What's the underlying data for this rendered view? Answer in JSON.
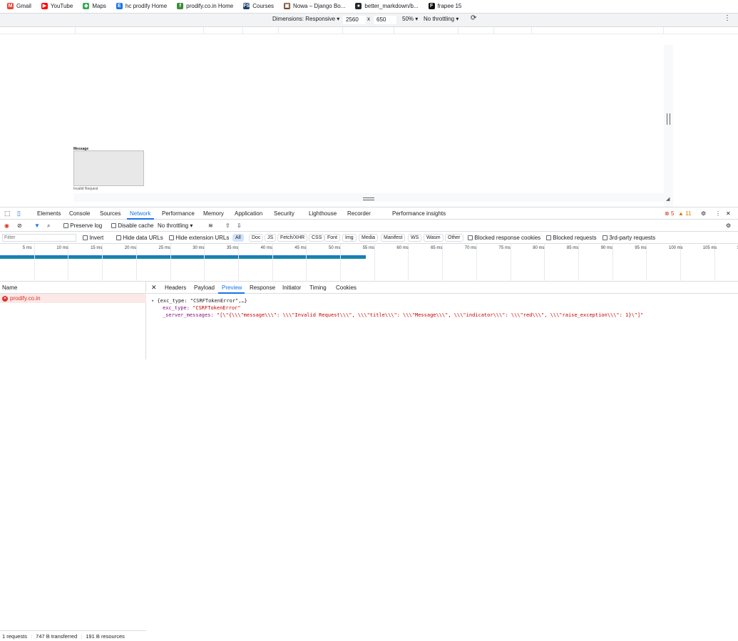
{
  "bookmarks": [
    {
      "label": "Gmail",
      "icon": "gmail-icon",
      "color": "#ea4335",
      "glyph": "M"
    },
    {
      "label": "YouTube",
      "icon": "youtube-icon",
      "color": "#ff0000",
      "glyph": "▶"
    },
    {
      "label": "Maps",
      "icon": "maps-icon",
      "color": "#34a853",
      "glyph": "◆"
    },
    {
      "label": "hc prodify Home",
      "icon": "prodify-icon",
      "color": "#1a73e8",
      "glyph": "E"
    },
    {
      "label": "prodify.co.in Home",
      "icon": "prodify-leaf-icon",
      "color": "#3c8c3c",
      "glyph": "f"
    },
    {
      "label": "Courses",
      "icon": "fs-icon",
      "color": "#1f3b73",
      "glyph": "FS"
    },
    {
      "label": "Nowa – Django Bo...",
      "icon": "nowa-icon",
      "color": "#7a4a2a",
      "glyph": "▣"
    },
    {
      "label": "better_markdown/b...",
      "icon": "github-icon",
      "color": "#24292e",
      "glyph": "●"
    },
    {
      "label": "frapee 15",
      "icon": "frappe-icon",
      "color": "#111111",
      "glyph": "F"
    }
  ],
  "device_toolbar": {
    "dimensions": "Dimensions: Responsive",
    "width": "2560",
    "times": "x",
    "height": "650",
    "zoom": "50%",
    "throttle": "No throttling"
  },
  "viewport": {
    "message_title": "Message",
    "message_text": "Invalid Request"
  },
  "devtools_tabs": [
    "Elements",
    "Console",
    "Sources",
    "Network",
    "Performance",
    "Memory",
    "Application",
    "Security",
    "Lighthouse",
    "Recorder",
    "Performance insights"
  ],
  "active_tab": "Network",
  "counts": {
    "errors": "5",
    "warnings": "11"
  },
  "toolbar": {
    "preserve_log": "Preserve log",
    "disable_cache": "Disable cache",
    "throttle": "No throttling"
  },
  "filter": {
    "placeholder": "Filter",
    "invert": "Invert",
    "hide_data_urls": "Hide data URLs",
    "hide_ext_urls": "Hide extension URLs",
    "types": [
      "All",
      "Doc",
      "JS",
      "Fetch/XHR",
      "CSS",
      "Font",
      "Img",
      "Media",
      "Manifest",
      "WS",
      "Wasm",
      "Other"
    ],
    "blocked_cookies": "Blocked response cookies",
    "blocked_requests": "Blocked requests",
    "third_party": "3rd-party requests"
  },
  "timeline": {
    "ticks": [
      "5 ms",
      "10 ms",
      "15 ms",
      "20 ms",
      "25 ms",
      "30 ms",
      "35 ms",
      "40 ms",
      "45 ms",
      "50 ms",
      "55 ms",
      "60 ms",
      "65 ms",
      "70 ms",
      "75 ms",
      "80 ms",
      "85 ms",
      "90 ms",
      "95 ms",
      "100 ms",
      "105 ms",
      "1"
    ]
  },
  "requests": {
    "header": "Name",
    "items": [
      {
        "name": "prodify.co.in"
      }
    ]
  },
  "status": {
    "requests": "1 requests",
    "transferred": "747 B transferred",
    "resources": "191 B resources"
  },
  "detail_tabs": [
    "Headers",
    "Payload",
    "Preview",
    "Response",
    "Initiator",
    "Timing",
    "Cookies"
  ],
  "active_detail_tab": "Preview",
  "preview": {
    "line1": "{exc_type: \"CSRFTokenError\",…}",
    "key1": "exc_type: ",
    "val1": "\"CSRFTokenError\"",
    "key2": "_server_messages: ",
    "val2": "\"[\\\"{\\\\\\\"message\\\\\\\": \\\\\\\"Invalid Request\\\\\\\", \\\\\\\"title\\\\\\\": \\\\\\\"Message\\\\\\\", \\\\\\\"indicator\\\\\\\": \\\\\\\"red\\\\\\\", \\\\\\\"raise_exception\\\\\\\": 1}\\\"]\""
  }
}
